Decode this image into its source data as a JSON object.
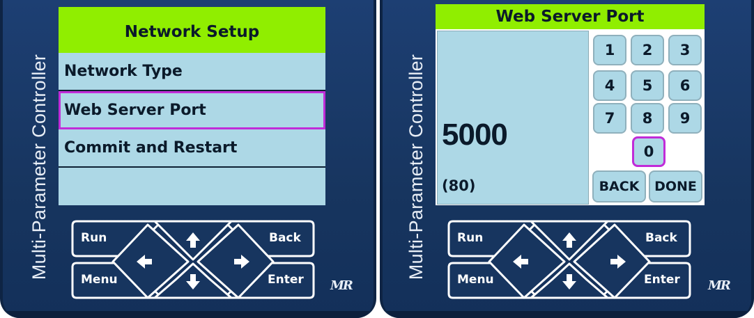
{
  "device": {
    "side_label": "Multi-Parameter Controller",
    "logo": "MR"
  },
  "left_screen": {
    "title": "Network Setup",
    "menu_items": [
      {
        "label": "Network Type",
        "selected": false
      },
      {
        "label": "Web Server Port",
        "selected": true
      },
      {
        "label": "Commit and Restart",
        "selected": false
      }
    ]
  },
  "right_screen": {
    "title": "Web Server Port",
    "value": "5000",
    "default_value": "(80)",
    "keys": [
      "1",
      "2",
      "3",
      "4",
      "5",
      "6",
      "7",
      "8",
      "9",
      "0"
    ],
    "selected_key": "0",
    "back_label": "BACK",
    "done_label": "DONE"
  },
  "hardware_keys": {
    "run": "Run",
    "menu": "Menu",
    "back": "Back",
    "enter": "Enter",
    "up_icon": "up-arrow-icon",
    "down_icon": "down-arrow-icon",
    "left_icon": "left-arrow-icon",
    "right_icon": "right-arrow-icon"
  },
  "colors": {
    "bezel": "#1d3f73",
    "screen": "#add8e6",
    "title_bar": "#90ee00",
    "selection": "#c02cd8"
  }
}
